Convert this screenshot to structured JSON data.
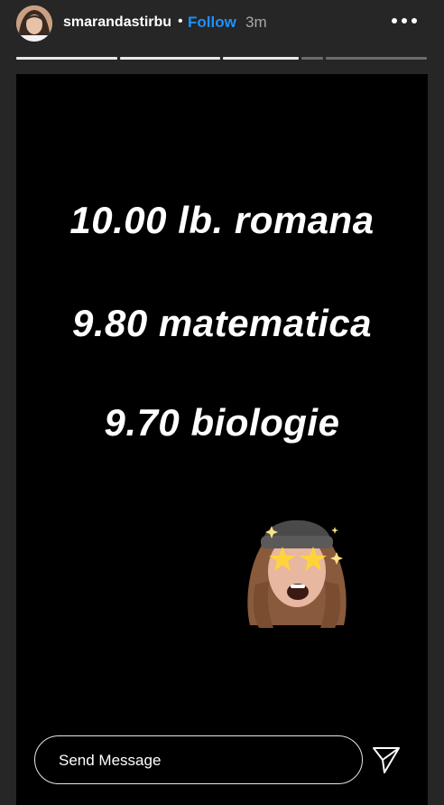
{
  "header": {
    "username": "smarandastirbu",
    "separator": "•",
    "follow_label": "Follow",
    "time_ago": "3m"
  },
  "progress_bars": [
    {
      "filled": 1.0
    },
    {
      "filled": 1.0
    },
    {
      "filled": 1.0
    },
    {
      "filled": 0.0
    },
    {
      "filled": 0.0
    }
  ],
  "story": {
    "lines": [
      "10.00 lb. romana",
      "9.80 matematica",
      "9.70 biologie"
    ],
    "sticker": "memoji-star-eyes"
  },
  "footer": {
    "message_placeholder": "Send Message",
    "send_icon": "send-icon"
  },
  "colors": {
    "background": "#262626",
    "story_background": "#000000",
    "follow": "#1e90ff"
  }
}
